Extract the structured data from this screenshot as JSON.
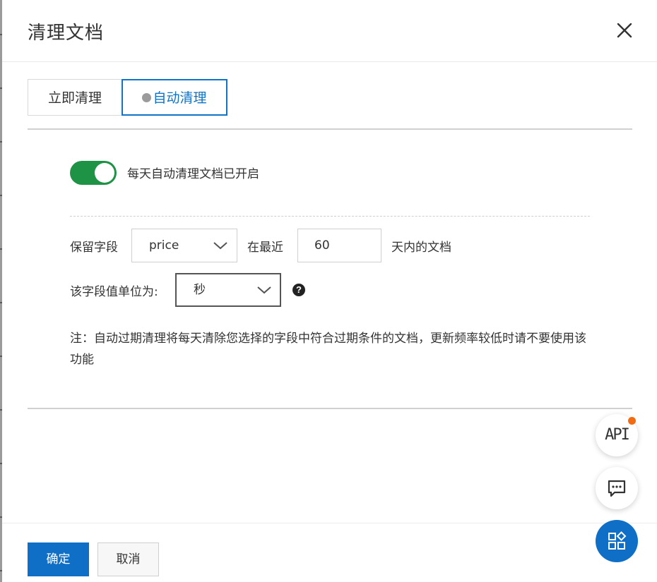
{
  "dialog": {
    "title": "清理文档",
    "close_icon": "close-icon"
  },
  "tabs": [
    {
      "label": "立即清理",
      "active": false
    },
    {
      "label": "自动清理",
      "active": true
    }
  ],
  "auto_clean": {
    "toggle_on": true,
    "toggle_label": "每天自动清理文档已开启",
    "field_label": "保留字段",
    "field_value": "price",
    "recent_label": "在最近",
    "days_value": "60",
    "days_suffix": "天内的文档",
    "unit_label": "该字段值单位为:",
    "unit_value": "秒",
    "help_icon": "question-circle-icon",
    "note": "注：自动过期清理将每天清除您选择的字段中符合过期条件的文档，更新频率较低时请不要使用该功能"
  },
  "footer": {
    "ok_label": "确定",
    "cancel_label": "取消"
  },
  "floating": {
    "api_label": "API",
    "chat_icon": "chat-icon",
    "apps_icon": "apps-icon"
  },
  "colors": {
    "primary": "#0f6fc6",
    "toggle_on": "#1e9245",
    "badge": "#f26b10"
  }
}
